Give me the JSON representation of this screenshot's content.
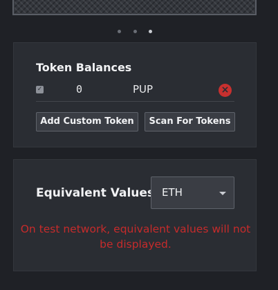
{
  "carousel": {
    "dots": 3,
    "active_index": 2
  },
  "tokens": {
    "title": "Token Balances",
    "rows": [
      {
        "checked": true,
        "balance": "0",
        "symbol": "PUP",
        "remove_icon": "close-circle-icon"
      }
    ],
    "add_button": "Add Custom Token",
    "scan_button": "Scan For Tokens"
  },
  "values": {
    "title": "Equivalent Values",
    "currency": "ETH",
    "warning": "On test network, equivalent values will not be displayed."
  },
  "colors": {
    "warning": "#c62b2b",
    "panel": "#2a2d33",
    "background": "#1f2126",
    "remove": "#c8302f"
  }
}
